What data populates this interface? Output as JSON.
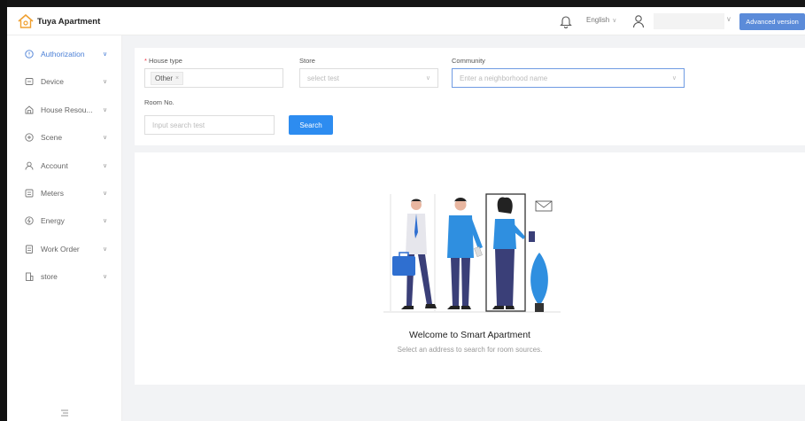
{
  "header": {
    "app_name": "Tuya Apartment",
    "language": "English",
    "language_caret": "∨",
    "user_caret": "∨",
    "advanced_button": "Advanced version"
  },
  "sidebar": {
    "items": [
      {
        "label": "Authorization",
        "icon": "authorization-icon",
        "active": true
      },
      {
        "label": "Device",
        "icon": "device-icon",
        "active": false
      },
      {
        "label": "House Resou...",
        "icon": "house-icon",
        "active": false
      },
      {
        "label": "Scene",
        "icon": "scene-icon",
        "active": false
      },
      {
        "label": "Account",
        "icon": "account-icon",
        "active": false
      },
      {
        "label": "Meters",
        "icon": "meters-icon",
        "active": false
      },
      {
        "label": "Energy",
        "icon": "energy-icon",
        "active": false
      },
      {
        "label": "Work Order",
        "icon": "work-order-icon",
        "active": false
      },
      {
        "label": "store",
        "icon": "store-icon",
        "active": false
      }
    ],
    "chevron": "∨"
  },
  "filters": {
    "house_type_label": "House type",
    "house_type_required": "*",
    "house_type_tag": "Other",
    "house_type_tag_close": "×",
    "store_label": "Store",
    "store_placeholder": "select test",
    "community_label": "Community",
    "community_placeholder": "Enter a neighborhood name",
    "room_label": "Room No.",
    "room_placeholder": "Input search test",
    "search_button": "Search",
    "caret": "∨"
  },
  "main": {
    "welcome_title": "Welcome to Smart Apartment",
    "welcome_subtitle": "Select an address to search for room sources."
  },
  "colors": {
    "accent": "#2d8cf0",
    "active_nav": "#4a7fd6",
    "advanced_button": "#5b8bd9",
    "logo": "#f0a030"
  }
}
